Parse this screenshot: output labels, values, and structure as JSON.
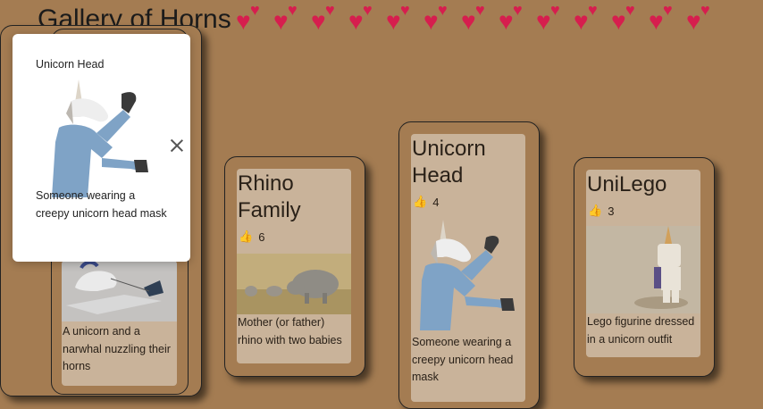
{
  "header": {
    "title": "Gallery of Horns",
    "heart_count": 13,
    "heart_color": "#d61e4e"
  },
  "background_color": "#a47c52",
  "cards": [
    {
      "title": "",
      "likes": "",
      "description": "A unicorn and a narwhal nuzzling their horns",
      "image_icon": "narwhal-unicorn-image"
    },
    {
      "title": "Rhino Family",
      "likes": "6",
      "description": "Mother (or father) rhino with two babies",
      "image_icon": "rhino-family-image"
    },
    {
      "title": "Unicorn Head",
      "likes": "4",
      "description": "Someone wearing a creepy unicorn head mask",
      "image_icon": "unicorn-head-image"
    },
    {
      "title": "UniLego",
      "likes": "3",
      "description": "Lego figurine dressed in a unicorn outfit",
      "image_icon": "unilego-image"
    }
  ],
  "modal": {
    "title": "Unicorn Head",
    "description": "Someone wearing a creepy unicorn head mask",
    "close_icon": "close-icon"
  },
  "like_icon": "thumbs-up-icon"
}
